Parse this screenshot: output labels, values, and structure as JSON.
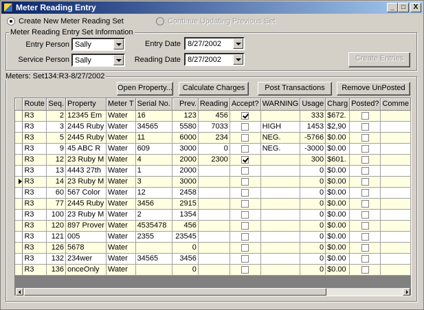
{
  "window": {
    "title": "Meter Reading Entry"
  },
  "title_buttons": {
    "minimize": "_",
    "maximize": "□",
    "close": "X"
  },
  "mode": {
    "create_new": "Create New Meter Reading Set",
    "continue_previous": "Continue Updating Previous Set"
  },
  "info_group": {
    "label": "Meter Reading Entry Set Information",
    "entry_person_label": "Entry Person",
    "entry_person_value": "Sally",
    "service_person_label": "Service Person",
    "service_person_value": "Sally",
    "entry_date_label": "Entry Date",
    "entry_date_value": "8/27/2002",
    "reading_date_label": "Reading  Date",
    "reading_date_value": "8/27/2002",
    "create_entries_button": "Create Entries"
  },
  "meters_group": {
    "label": "Meters: Set134:R3-8/27/2002",
    "buttons": {
      "open_property": "Open Property...",
      "calculate_charges": "Calculate Charges",
      "post_transactions": "Post Transactions",
      "remove_unposted": "Remove UnPosted"
    }
  },
  "grid": {
    "columns": [
      "Route",
      "Seq.",
      "Property",
      "Meter T",
      "Serial No.",
      "Prev.",
      "Reading",
      "Accept?",
      "WARNING",
      "Usage",
      "Charg",
      "Posted?",
      "Comme"
    ],
    "current_row": 6,
    "rows": [
      {
        "route": "R3",
        "seq": "2",
        "property": "12345 Em",
        "meter": "Water",
        "serial": "16",
        "prev": "123",
        "reading": "456",
        "accept": true,
        "warning": "",
        "usage": "333",
        "charge": "$672.",
        "posted": false,
        "comment": ""
      },
      {
        "route": "R3",
        "seq": "3",
        "property": "2445 Ruby",
        "meter": "Water",
        "serial": "34565",
        "prev": "5580",
        "reading": "7033",
        "accept": false,
        "warning": "HIGH",
        "usage": "1453",
        "charge": "$2,90",
        "posted": false,
        "comment": ""
      },
      {
        "route": "R3",
        "seq": "5",
        "property": "2445 Ruby",
        "meter": "Water",
        "serial": "11",
        "prev": "6000",
        "reading": "234",
        "accept": false,
        "warning": "NEG.",
        "usage": "-5766",
        "charge": "$0.00",
        "posted": false,
        "comment": ""
      },
      {
        "route": "R3",
        "seq": "9",
        "property": "45 ABC R",
        "meter": "Water",
        "serial": "609",
        "prev": "3000",
        "reading": "0",
        "accept": false,
        "warning": "NEG.",
        "usage": "-3000",
        "charge": "$0.00",
        "posted": false,
        "comment": ""
      },
      {
        "route": "R3",
        "seq": "12",
        "property": "23 Ruby M",
        "meter": "Water",
        "serial": "4",
        "prev": "2000",
        "reading": "2300",
        "accept": true,
        "warning": "",
        "usage": "300",
        "charge": "$601.",
        "posted": false,
        "comment": ""
      },
      {
        "route": "R3",
        "seq": "13",
        "property": "4443 27th",
        "meter": "Water",
        "serial": "1",
        "prev": "2000",
        "reading": "",
        "accept": false,
        "warning": "",
        "usage": "0",
        "charge": "$0.00",
        "posted": false,
        "comment": ""
      },
      {
        "route": "R3",
        "seq": "14",
        "property": "23 Ruby M",
        "meter": "Water",
        "serial": "3",
        "prev": "3000",
        "reading": "",
        "accept": false,
        "warning": "",
        "usage": "0",
        "charge": "$0.00",
        "posted": false,
        "comment": ""
      },
      {
        "route": "R3",
        "seq": "60",
        "property": "567 Color",
        "meter": "Water",
        "serial": "12",
        "prev": "2458",
        "reading": "",
        "accept": false,
        "warning": "",
        "usage": "0",
        "charge": "$0.00",
        "posted": false,
        "comment": ""
      },
      {
        "route": "R3",
        "seq": "77",
        "property": "2445 Ruby",
        "meter": "Water",
        "serial": "3456",
        "prev": "2915",
        "reading": "",
        "accept": false,
        "warning": "",
        "usage": "0",
        "charge": "$0.00",
        "posted": false,
        "comment": ""
      },
      {
        "route": "R3",
        "seq": "100",
        "property": "23 Ruby M",
        "meter": "Water",
        "serial": "2",
        "prev": "1354",
        "reading": "",
        "accept": false,
        "warning": "",
        "usage": "0",
        "charge": "$0.00",
        "posted": false,
        "comment": ""
      },
      {
        "route": "R3",
        "seq": "120",
        "property": "897 Prover",
        "meter": "Water",
        "serial": "4535478",
        "prev": "456",
        "reading": "",
        "accept": false,
        "warning": "",
        "usage": "0",
        "charge": "$0.00",
        "posted": false,
        "comment": ""
      },
      {
        "route": "R3",
        "seq": "121",
        "property": "005",
        "meter": "Water",
        "serial": "2355",
        "prev": "23545",
        "reading": "",
        "accept": false,
        "warning": "",
        "usage": "0",
        "charge": "$0.00",
        "posted": false,
        "comment": ""
      },
      {
        "route": "R3",
        "seq": "126",
        "property": "5678",
        "meter": "Water",
        "serial": "",
        "prev": "0",
        "reading": "",
        "accept": false,
        "warning": "",
        "usage": "0",
        "charge": "$0.00",
        "posted": false,
        "comment": ""
      },
      {
        "route": "R3",
        "seq": "132",
        "property": "234wer",
        "meter": "Water",
        "serial": "34565",
        "prev": "3456",
        "reading": "",
        "accept": false,
        "warning": "",
        "usage": "0",
        "charge": "$0.00",
        "posted": false,
        "comment": ""
      },
      {
        "route": "R3",
        "seq": "136",
        "property": "onceOnly",
        "meter": "Water",
        "serial": "",
        "prev": "0",
        "reading": "",
        "accept": false,
        "warning": "",
        "usage": "0",
        "charge": "$0.00",
        "posted": false,
        "comment": ""
      }
    ]
  }
}
